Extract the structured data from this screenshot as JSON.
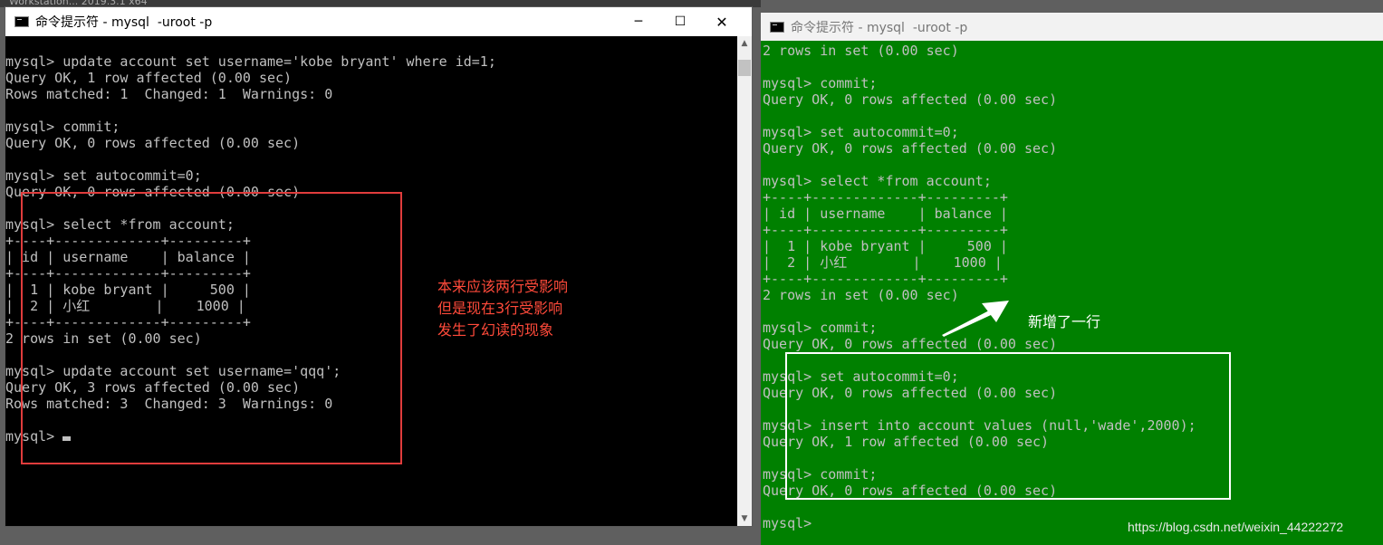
{
  "top_strip_text": "Workstation... 2019.3.1 x64",
  "left_window": {
    "title": "命令提示符 - mysql  -uroot -p",
    "controls": {
      "minimize": "─",
      "maximize": "☐",
      "close": "✕"
    },
    "lines": [
      "mysql> update account set username='kobe bryant' where id=1;",
      "Query OK, 1 row affected (0.00 sec)",
      "Rows matched: 1  Changed: 1  Warnings: 0",
      "",
      "mysql> commit;",
      "Query OK, 0 rows affected (0.00 sec)",
      "",
      "mysql> set autocommit=0;",
      "Query OK, 0 rows affected (0.00 sec)",
      "",
      "mysql> select *from account;",
      "+----+-------------+---------+",
      "| id | username    | balance |",
      "+----+-------------+---------+",
      "|  1 | kobe bryant |     500 |",
      "|  2 | 小红        |    1000 |",
      "+----+-------------+---------+",
      "2 rows in set (0.00 sec)",
      "",
      "mysql> update account set username='qqq';",
      "Query OK, 3 rows affected (0.00 sec)",
      "Rows matched: 3  Changed: 3  Warnings: 0",
      "",
      "mysql> "
    ]
  },
  "right_window": {
    "title": "命令提示符 - mysql  -uroot -p",
    "lines": [
      "2 rows in set (0.00 sec)",
      "",
      "mysql> commit;",
      "Query OK, 0 rows affected (0.00 sec)",
      "",
      "mysql> set autocommit=0;",
      "Query OK, 0 rows affected (0.00 sec)",
      "",
      "mysql> select *from account;",
      "+----+-------------+---------+",
      "| id | username    | balance |",
      "+----+-------------+---------+",
      "|  1 | kobe bryant |     500 |",
      "|  2 | 小红        |    1000 |",
      "+----+-------------+---------+",
      "2 rows in set (0.00 sec)",
      "",
      "mysql> commit;",
      "Query OK, 0 rows affected (0.00 sec)",
      "",
      "mysql> set autocommit=0;",
      "Query OK, 0 rows affected (0.00 sec)",
      "",
      "mysql> insert into account values (null,'wade',2000);",
      "Query OK, 1 row affected (0.00 sec)",
      "",
      "mysql> commit;",
      "Query OK, 0 rows affected (0.00 sec)",
      "",
      "mysql>"
    ]
  },
  "annotations": {
    "red_note": [
      "本来应该两行受影响",
      "但是现在3行受影响",
      "发生了幻读的现象"
    ],
    "white_note": "新增了一行"
  },
  "watermark": "https://blog.csdn.net/weixin_44222272",
  "colors": {
    "left_console_bg": "#000000",
    "right_console_bg": "#008000",
    "console_text": "#c0c0c0",
    "red_annotation": "#e03c3c",
    "white_annotation": "#ffffff"
  }
}
